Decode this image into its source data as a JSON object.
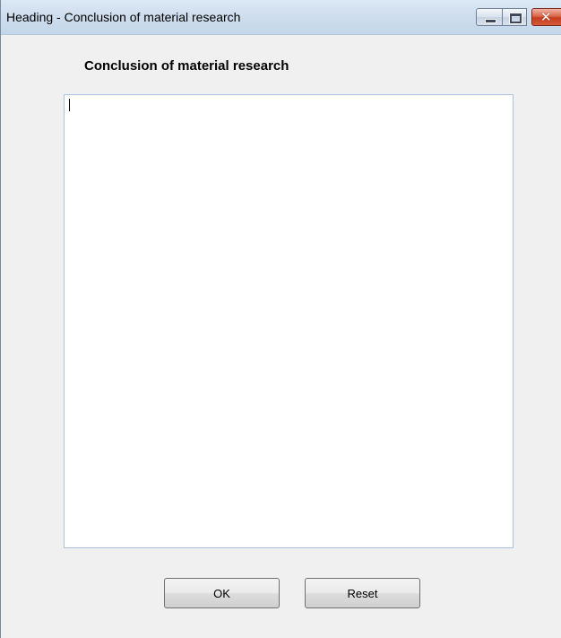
{
  "window": {
    "title": "Heading - Conclusion of material research"
  },
  "heading": "Conclusion of material research",
  "editor": {
    "value": ""
  },
  "buttons": {
    "ok_label": "OK",
    "reset_label": "Reset"
  },
  "controls": {
    "minimize_icon": "minimize-icon",
    "maximize_icon": "maximize-icon",
    "close_icon": "close-icon",
    "close_color": "#c43c1f"
  }
}
